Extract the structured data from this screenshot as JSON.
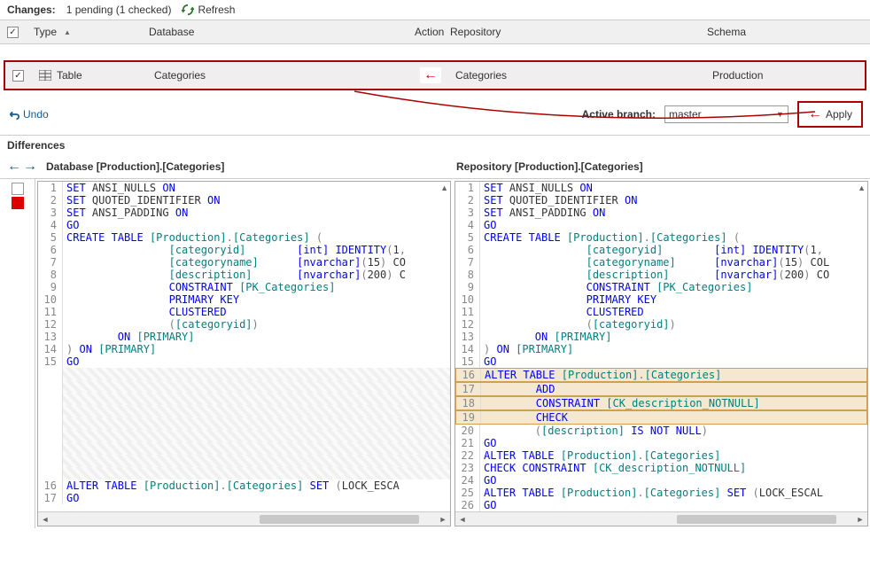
{
  "changes": {
    "label": "Changes:",
    "status": "1 pending (1 checked)",
    "refresh": "Refresh"
  },
  "columns": {
    "type": "Type",
    "database": "Database",
    "action": "Action",
    "repository": "Repository",
    "schema": "Schema"
  },
  "row": {
    "type": "Table",
    "database": "Categories",
    "repository": "Categories",
    "schema": "Production"
  },
  "toolbar": {
    "undo": "Undo",
    "active_branch_label": "Active branch:",
    "branch": "master",
    "apply": "Apply"
  },
  "diffs": {
    "label": "Differences",
    "db_title": "Database [Production].[Categories]",
    "repo_title": "Repository [Production].[Categories]"
  },
  "db_code": [
    {
      "n": 1,
      "t": [
        [
          "kw-blue",
          "SET"
        ],
        [
          "",
          " ANSI_NULLS "
        ],
        [
          "kw-blue",
          "ON"
        ]
      ]
    },
    {
      "n": 2,
      "t": [
        [
          "kw-blue",
          "SET"
        ],
        [
          "",
          " QUOTED_IDENTIFIER "
        ],
        [
          "kw-blue",
          "ON"
        ]
      ]
    },
    {
      "n": 3,
      "t": [
        [
          "kw-blue",
          "SET"
        ],
        [
          "",
          " ANSI_PADDING "
        ],
        [
          "kw-blue",
          "ON"
        ]
      ]
    },
    {
      "n": 4,
      "t": [
        [
          "kw-blue",
          "GO"
        ]
      ]
    },
    {
      "n": 5,
      "t": [
        [
          "kw-blue",
          "CREATE"
        ],
        [
          "",
          " "
        ],
        [
          "kw-blue",
          "TABLE"
        ],
        [
          "",
          " "
        ],
        [
          "kw-teal",
          "[Production]"
        ],
        [
          "kw-gray",
          "."
        ],
        [
          "kw-teal",
          "[Categories]"
        ],
        [
          "",
          " "
        ],
        [
          "kw-gray",
          "("
        ]
      ]
    },
    {
      "n": 6,
      "t": [
        [
          "",
          "                "
        ],
        [
          "kw-teal",
          "[categoryid]"
        ],
        [
          "",
          "        "
        ],
        [
          "kw-blue",
          "[int]"
        ],
        [
          "",
          " "
        ],
        [
          "kw-blue",
          "IDENTITY"
        ],
        [
          "kw-gray",
          "("
        ],
        [
          "",
          "1"
        ],
        [
          "kw-gray",
          ","
        ]
      ]
    },
    {
      "n": 7,
      "t": [
        [
          "",
          "                "
        ],
        [
          "kw-teal",
          "[categoryname]"
        ],
        [
          "",
          "      "
        ],
        [
          "kw-blue",
          "[nvarchar]"
        ],
        [
          "kw-gray",
          "("
        ],
        [
          "",
          "15"
        ],
        [
          "kw-gray",
          ")"
        ],
        [
          "",
          " CO"
        ]
      ]
    },
    {
      "n": 8,
      "t": [
        [
          "",
          "                "
        ],
        [
          "kw-teal",
          "[description]"
        ],
        [
          "",
          "       "
        ],
        [
          "kw-blue",
          "[nvarchar]"
        ],
        [
          "kw-gray",
          "("
        ],
        [
          "",
          "200"
        ],
        [
          "kw-gray",
          ")"
        ],
        [
          "",
          " C"
        ]
      ]
    },
    {
      "n": 9,
      "t": [
        [
          "",
          "                "
        ],
        [
          "kw-blue",
          "CONSTRAINT"
        ],
        [
          "",
          " "
        ],
        [
          "kw-teal",
          "[PK_Categories]"
        ]
      ]
    },
    {
      "n": 10,
      "t": [
        [
          "",
          "                "
        ],
        [
          "kw-blue",
          "PRIMARY"
        ],
        [
          "",
          " "
        ],
        [
          "kw-blue",
          "KEY"
        ]
      ]
    },
    {
      "n": 11,
      "t": [
        [
          "",
          "                "
        ],
        [
          "kw-blue",
          "CLUSTERED"
        ]
      ]
    },
    {
      "n": 12,
      "t": [
        [
          "",
          "                "
        ],
        [
          "kw-gray",
          "("
        ],
        [
          "kw-teal",
          "[categoryid]"
        ],
        [
          "kw-gray",
          ")"
        ]
      ]
    },
    {
      "n": 13,
      "t": [
        [
          "",
          "        "
        ],
        [
          "kw-blue",
          "ON"
        ],
        [
          "",
          " "
        ],
        [
          "kw-teal",
          "[PRIMARY]"
        ]
      ]
    },
    {
      "n": 14,
      "t": [
        [
          "kw-gray",
          ")"
        ],
        [
          "",
          " "
        ],
        [
          "kw-blue",
          "ON"
        ],
        [
          "",
          " "
        ],
        [
          "kw-teal",
          "[PRIMARY]"
        ]
      ]
    },
    {
      "n": 15,
      "t": [
        [
          "kw-blue",
          "GO"
        ]
      ]
    }
  ],
  "db_code_bottom": [
    {
      "n": 16,
      "t": [
        [
          "kw-blue",
          "ALTER"
        ],
        [
          "",
          " "
        ],
        [
          "kw-blue",
          "TABLE"
        ],
        [
          "",
          " "
        ],
        [
          "kw-teal",
          "[Production]"
        ],
        [
          "kw-gray",
          "."
        ],
        [
          "kw-teal",
          "[Categories]"
        ],
        [
          "",
          " "
        ],
        [
          "kw-blue",
          "SET"
        ],
        [
          "",
          " "
        ],
        [
          "kw-gray",
          "("
        ],
        [
          "",
          "LOCK_ESCA"
        ]
      ]
    },
    {
      "n": 17,
      "t": [
        [
          "kw-blue",
          "GO"
        ]
      ]
    }
  ],
  "repo_code": [
    {
      "n": 1,
      "t": [
        [
          "kw-blue",
          "SET"
        ],
        [
          "",
          " ANSI_NULLS "
        ],
        [
          "kw-blue",
          "ON"
        ]
      ]
    },
    {
      "n": 2,
      "t": [
        [
          "kw-blue",
          "SET"
        ],
        [
          "",
          " QUOTED_IDENTIFIER "
        ],
        [
          "kw-blue",
          "ON"
        ]
      ]
    },
    {
      "n": 3,
      "t": [
        [
          "kw-blue",
          "SET"
        ],
        [
          "",
          " ANSI_PADDING "
        ],
        [
          "kw-blue",
          "ON"
        ]
      ]
    },
    {
      "n": 4,
      "t": [
        [
          "kw-blue",
          "GO"
        ]
      ]
    },
    {
      "n": 5,
      "t": [
        [
          "kw-blue",
          "CREATE"
        ],
        [
          "",
          " "
        ],
        [
          "kw-blue",
          "TABLE"
        ],
        [
          "",
          " "
        ],
        [
          "kw-teal",
          "[Production]"
        ],
        [
          "kw-gray",
          "."
        ],
        [
          "kw-teal",
          "[Categories]"
        ],
        [
          "",
          " "
        ],
        [
          "kw-gray",
          "("
        ]
      ]
    },
    {
      "n": 6,
      "t": [
        [
          "",
          "                "
        ],
        [
          "kw-teal",
          "[categoryid]"
        ],
        [
          "",
          "        "
        ],
        [
          "kw-blue",
          "[int]"
        ],
        [
          "",
          " "
        ],
        [
          "kw-blue",
          "IDENTITY"
        ],
        [
          "kw-gray",
          "("
        ],
        [
          "",
          "1"
        ],
        [
          "kw-gray",
          ","
        ]
      ]
    },
    {
      "n": 7,
      "t": [
        [
          "",
          "                "
        ],
        [
          "kw-teal",
          "[categoryname]"
        ],
        [
          "",
          "      "
        ],
        [
          "kw-blue",
          "[nvarchar]"
        ],
        [
          "kw-gray",
          "("
        ],
        [
          "",
          "15"
        ],
        [
          "kw-gray",
          ")"
        ],
        [
          "",
          " COL"
        ]
      ]
    },
    {
      "n": 8,
      "t": [
        [
          "",
          "                "
        ],
        [
          "kw-teal",
          "[description]"
        ],
        [
          "",
          "       "
        ],
        [
          "kw-blue",
          "[nvarchar]"
        ],
        [
          "kw-gray",
          "("
        ],
        [
          "",
          "200"
        ],
        [
          "kw-gray",
          ")"
        ],
        [
          "",
          " CO"
        ]
      ]
    },
    {
      "n": 9,
      "t": [
        [
          "",
          "                "
        ],
        [
          "kw-blue",
          "CONSTRAINT"
        ],
        [
          "",
          " "
        ],
        [
          "kw-teal",
          "[PK_Categories]"
        ]
      ]
    },
    {
      "n": 10,
      "t": [
        [
          "",
          "                "
        ],
        [
          "kw-blue",
          "PRIMARY"
        ],
        [
          "",
          " "
        ],
        [
          "kw-blue",
          "KEY"
        ]
      ]
    },
    {
      "n": 11,
      "t": [
        [
          "",
          "                "
        ],
        [
          "kw-blue",
          "CLUSTERED"
        ]
      ]
    },
    {
      "n": 12,
      "t": [
        [
          "",
          "                "
        ],
        [
          "kw-gray",
          "("
        ],
        [
          "kw-teal",
          "[categoryid]"
        ],
        [
          "kw-gray",
          ")"
        ]
      ]
    },
    {
      "n": 13,
      "t": [
        [
          "",
          "        "
        ],
        [
          "kw-blue",
          "ON"
        ],
        [
          "",
          " "
        ],
        [
          "kw-teal",
          "[PRIMARY]"
        ]
      ]
    },
    {
      "n": 14,
      "t": [
        [
          "kw-gray",
          ")"
        ],
        [
          "",
          " "
        ],
        [
          "kw-blue",
          "ON"
        ],
        [
          "",
          " "
        ],
        [
          "kw-teal",
          "[PRIMARY]"
        ]
      ]
    },
    {
      "n": 15,
      "t": [
        [
          "kw-blue",
          "GO"
        ]
      ]
    },
    {
      "n": 16,
      "diff": true,
      "t": [
        [
          "kw-blue",
          "ALTER"
        ],
        [
          "",
          " "
        ],
        [
          "kw-blue",
          "TABLE"
        ],
        [
          "",
          " "
        ],
        [
          "kw-teal",
          "[Production]"
        ],
        [
          "kw-gray",
          "."
        ],
        [
          "kw-teal",
          "[Categories]"
        ]
      ]
    },
    {
      "n": 17,
      "diff": true,
      "t": [
        [
          "",
          "        "
        ],
        [
          "kw-blue",
          "ADD"
        ]
      ]
    },
    {
      "n": 18,
      "diff": true,
      "t": [
        [
          "",
          "        "
        ],
        [
          "kw-blue",
          "CONSTRAINT"
        ],
        [
          "",
          " "
        ],
        [
          "kw-teal",
          "[CK_description_NOTNULL]"
        ]
      ]
    },
    {
      "n": 19,
      "diff": true,
      "t": [
        [
          "",
          "        "
        ],
        [
          "kw-blue",
          "CHECK"
        ]
      ]
    },
    {
      "n": 20,
      "t": [
        [
          "",
          "        "
        ],
        [
          "kw-gray",
          "("
        ],
        [
          "kw-teal",
          "[description]"
        ],
        [
          "",
          " "
        ],
        [
          "kw-blue",
          "IS"
        ],
        [
          "",
          " "
        ],
        [
          "kw-blue",
          "NOT"
        ],
        [
          "",
          " "
        ],
        [
          "kw-blue",
          "NULL"
        ],
        [
          "kw-gray",
          ")"
        ]
      ]
    },
    {
      "n": 21,
      "t": [
        [
          "kw-blue",
          "GO"
        ]
      ]
    },
    {
      "n": 22,
      "t": [
        [
          "kw-blue",
          "ALTER"
        ],
        [
          "",
          " "
        ],
        [
          "kw-blue",
          "TABLE"
        ],
        [
          "",
          " "
        ],
        [
          "kw-teal",
          "[Production]"
        ],
        [
          "kw-gray",
          "."
        ],
        [
          "kw-teal",
          "[Categories]"
        ]
      ]
    },
    {
      "n": 23,
      "t": [
        [
          "kw-blue",
          "CHECK"
        ],
        [
          "",
          " "
        ],
        [
          "kw-blue",
          "CONSTRAINT"
        ],
        [
          "",
          " "
        ],
        [
          "kw-teal",
          "[CK_description_NOTNULL]"
        ]
      ]
    },
    {
      "n": 24,
      "t": [
        [
          "kw-blue",
          "GO"
        ]
      ]
    },
    {
      "n": 25,
      "t": [
        [
          "kw-blue",
          "ALTER"
        ],
        [
          "",
          " "
        ],
        [
          "kw-blue",
          "TABLE"
        ],
        [
          "",
          " "
        ],
        [
          "kw-teal",
          "[Production]"
        ],
        [
          "kw-gray",
          "."
        ],
        [
          "kw-teal",
          "[Categories]"
        ],
        [
          "",
          " "
        ],
        [
          "kw-blue",
          "SET"
        ],
        [
          "",
          " "
        ],
        [
          "kw-gray",
          "("
        ],
        [
          "",
          "LOCK_ESCAL"
        ]
      ]
    },
    {
      "n": 26,
      "t": [
        [
          "kw-blue",
          "GO"
        ]
      ]
    }
  ]
}
